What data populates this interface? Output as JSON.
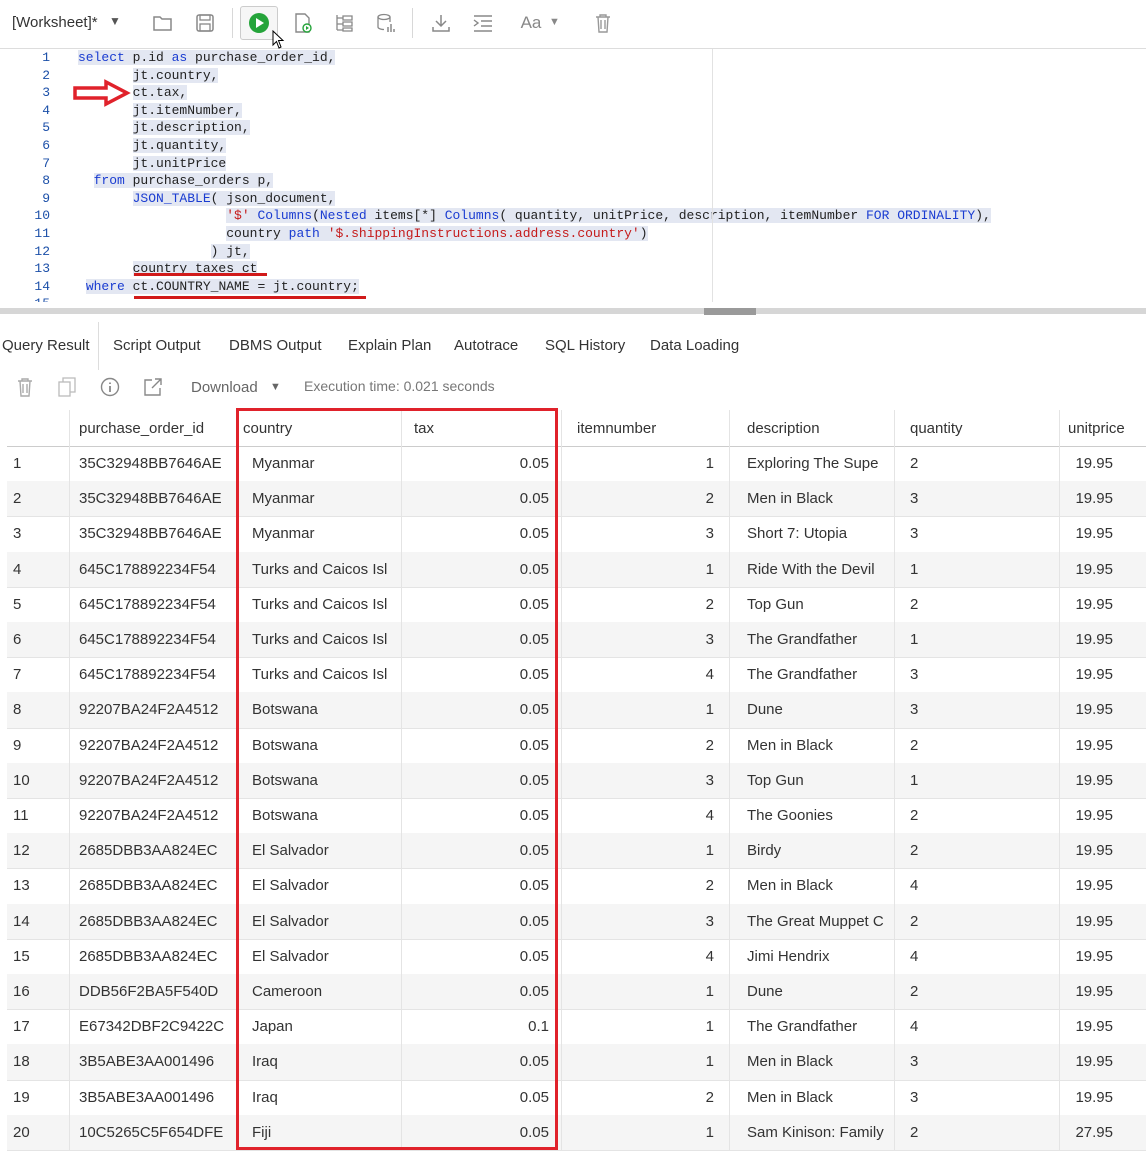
{
  "toolbar": {
    "worksheet_title": "[Worksheet]*",
    "icons": [
      "open-icon",
      "save-icon",
      "run-statement-icon",
      "run-script-icon",
      "explain-plan-icon",
      "autotrace-icon",
      "download-icon",
      "format-icon",
      "case-icon",
      "delete-icon"
    ]
  },
  "editor": {
    "line_numbers": [
      "1",
      "2",
      "3",
      "4",
      "5",
      "6",
      "7",
      "8",
      "9",
      "10",
      "11",
      "12",
      "13",
      "14",
      "15"
    ],
    "lines": [
      "select p.id as purchase_order_id,",
      "       jt.country,",
      "       ct.tax,",
      "       jt.itemNumber,",
      "       jt.description,",
      "       jt.quantity,",
      "       jt.unitPrice",
      "  from purchase_orders p,",
      "       JSON_TABLE( json_document,",
      "                   '$' Columns(Nested items[*] Columns( quantity, unitPrice, description, itemNumber FOR ORDINALITY),",
      "                   country path '$.shippingInstructions.address.country')",
      "                 ) jt,",
      "       country_taxes ct",
      " where ct.COUNTRY_NAME = jt.country;",
      ""
    ]
  },
  "tabs": [
    "Query Result",
    "Script Output",
    "DBMS Output",
    "Explain Plan",
    "Autotrace",
    "SQL History",
    "Data Loading"
  ],
  "result_toolbar": {
    "download_label": "Download",
    "execution_time": "Execution time: 0.021 seconds"
  },
  "grid": {
    "columns": [
      "",
      "purchase_order_id",
      "country",
      "tax",
      "itemnumber",
      "description",
      "quantity",
      "unitprice"
    ],
    "rows": [
      [
        "1",
        "35C32948BB7646AE",
        "Myanmar",
        "0.05",
        "1",
        "Exploring The Supe",
        "2",
        "19.95"
      ],
      [
        "2",
        "35C32948BB7646AE",
        "Myanmar",
        "0.05",
        "2",
        "Men in Black",
        "3",
        "19.95"
      ],
      [
        "3",
        "35C32948BB7646AE",
        "Myanmar",
        "0.05",
        "3",
        "Short 7: Utopia",
        "3",
        "19.95"
      ],
      [
        "4",
        "645C178892234F54",
        "Turks and Caicos Isl",
        "0.05",
        "1",
        "Ride With the Devil",
        "1",
        "19.95"
      ],
      [
        "5",
        "645C178892234F54",
        "Turks and Caicos Isl",
        "0.05",
        "2",
        "Top Gun",
        "2",
        "19.95"
      ],
      [
        "6",
        "645C178892234F54",
        "Turks and Caicos Isl",
        "0.05",
        "3",
        "The Grandfather",
        "1",
        "19.95"
      ],
      [
        "7",
        "645C178892234F54",
        "Turks and Caicos Isl",
        "0.05",
        "4",
        "The Grandfather",
        "3",
        "19.95"
      ],
      [
        "8",
        "92207BA24F2A4512",
        "Botswana",
        "0.05",
        "1",
        "Dune",
        "3",
        "19.95"
      ],
      [
        "9",
        "92207BA24F2A4512",
        "Botswana",
        "0.05",
        "2",
        "Men in Black",
        "2",
        "19.95"
      ],
      [
        "10",
        "92207BA24F2A4512",
        "Botswana",
        "0.05",
        "3",
        "Top Gun",
        "1",
        "19.95"
      ],
      [
        "11",
        "92207BA24F2A4512",
        "Botswana",
        "0.05",
        "4",
        "The Goonies",
        "2",
        "19.95"
      ],
      [
        "12",
        "2685DBB3AA824EC",
        "El Salvador",
        "0.05",
        "1",
        "Birdy",
        "2",
        "19.95"
      ],
      [
        "13",
        "2685DBB3AA824EC",
        "El Salvador",
        "0.05",
        "2",
        "Men in Black",
        "4",
        "19.95"
      ],
      [
        "14",
        "2685DBB3AA824EC",
        "El Salvador",
        "0.05",
        "3",
        "The Great Muppet C",
        "2",
        "19.95"
      ],
      [
        "15",
        "2685DBB3AA824EC",
        "El Salvador",
        "0.05",
        "4",
        "Jimi Hendrix",
        "4",
        "19.95"
      ],
      [
        "16",
        "DDB56F2BA5F540D",
        "Cameroon",
        "0.05",
        "1",
        "Dune",
        "2",
        "19.95"
      ],
      [
        "17",
        "E67342DBF2C9422C",
        "Japan",
        "0.1",
        "1",
        "The Grandfather",
        "4",
        "19.95"
      ],
      [
        "18",
        "3B5ABE3AA001496",
        "Iraq",
        "0.05",
        "1",
        "Men in Black",
        "3",
        "19.95"
      ],
      [
        "19",
        "3B5ABE3AA001496",
        "Iraq",
        "0.05",
        "2",
        "Men in Black",
        "3",
        "19.95"
      ],
      [
        "20",
        "10C5265C5F654DFE",
        "Fiji",
        "0.05",
        "1",
        "Sam Kinison: Family",
        "2",
        "27.95"
      ]
    ]
  },
  "colors": {
    "annotation_red": "#e0222b",
    "run_green": "#25a43a",
    "keyword_blue": "#1a3cd1",
    "string_red": "#c51a1a"
  }
}
